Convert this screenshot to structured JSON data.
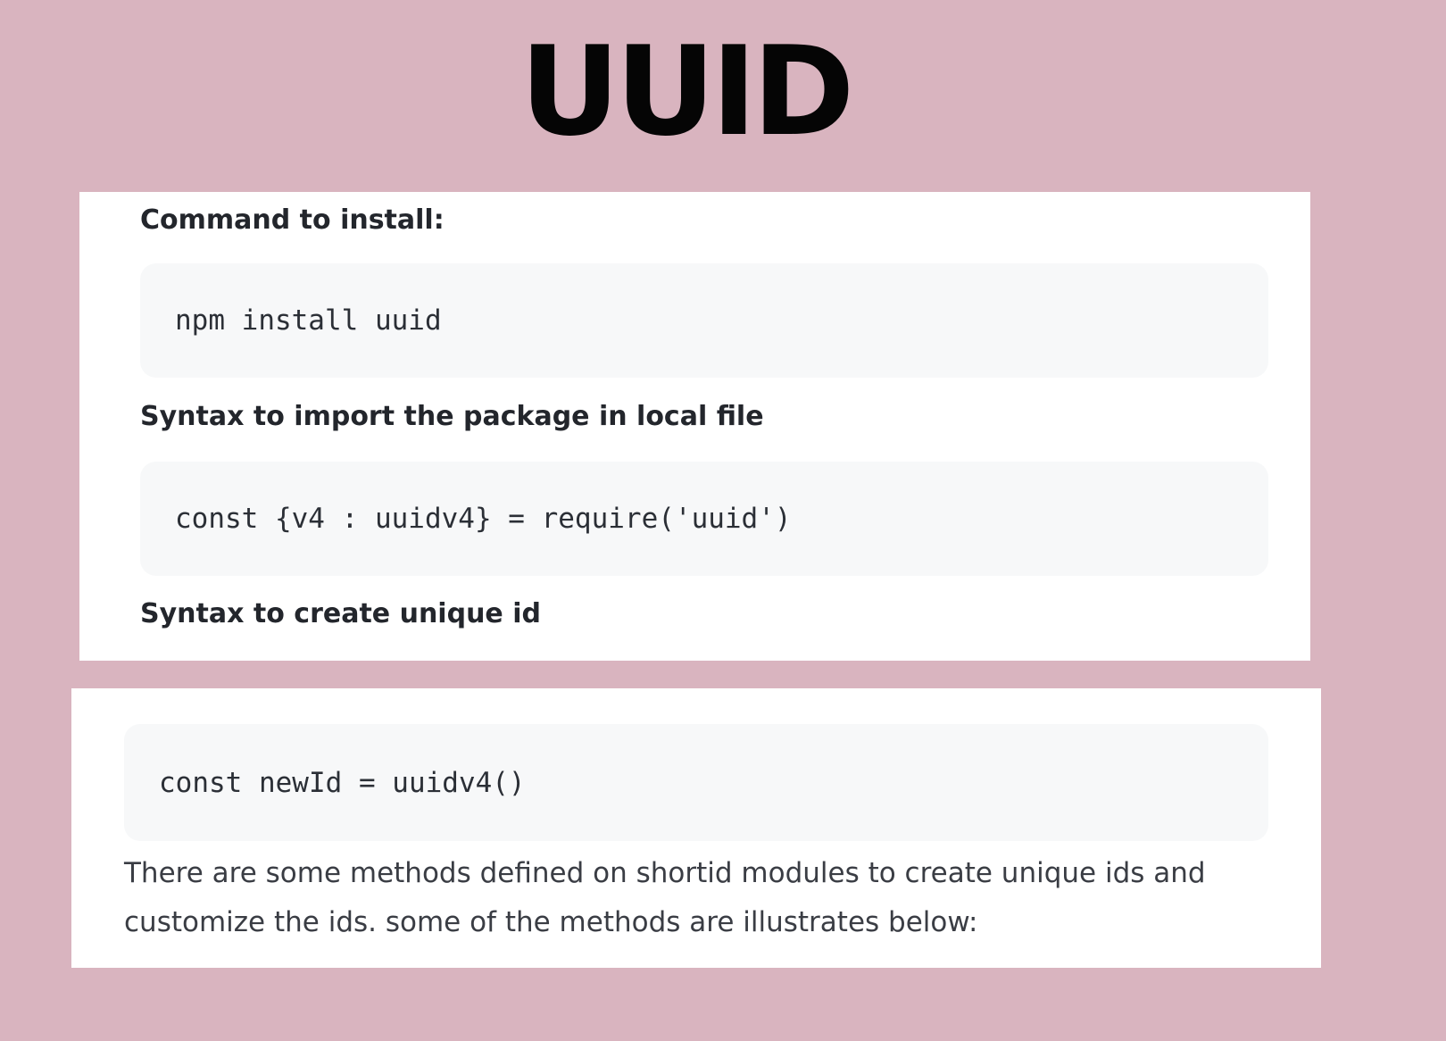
{
  "title": "UUID",
  "sections": [
    {
      "label": "Command to install:",
      "code": "npm install uuid"
    },
    {
      "label": "Syntax to import the package in local file",
      "code": "const {v4 : uuidv4} = require('uuid')"
    },
    {
      "label": "Syntax to create unique id",
      "code": "const newId = uuidv4()"
    }
  ],
  "description": "There are some methods defined on shortid modules to create unique ids and customize the ids. some of the methods are illustrates below:",
  "colors": {
    "background": "#d9b4bf",
    "panel": "#ffffff",
    "code_background": "#f7f8f9",
    "title": "#050505",
    "text": "#23262c"
  }
}
